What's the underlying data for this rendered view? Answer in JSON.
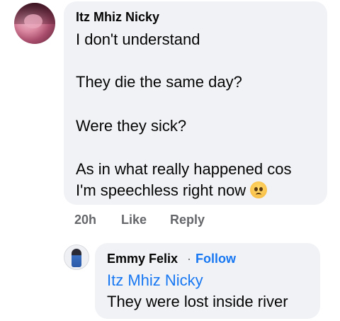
{
  "comment": {
    "author": "Itz Mhiz Nicky",
    "lines": [
      "I don't understand",
      "",
      "They die the same day?",
      "",
      "Were they sick?",
      "",
      "As in what really happened cos",
      "I'm speechless right now"
    ],
    "emoji": "worried-face-emoji",
    "time": "20h",
    "like_label": "Like",
    "reply_label": "Reply"
  },
  "reply": {
    "author": "Emmy Felix",
    "separator": "·",
    "follow_label": "Follow",
    "mention": "Itz Mhiz Nicky",
    "text": "They were lost inside river"
  },
  "colors": {
    "bubble": "#f0f2f5",
    "link": "#1877f2",
    "meta": "#65676b",
    "text": "#050505"
  }
}
